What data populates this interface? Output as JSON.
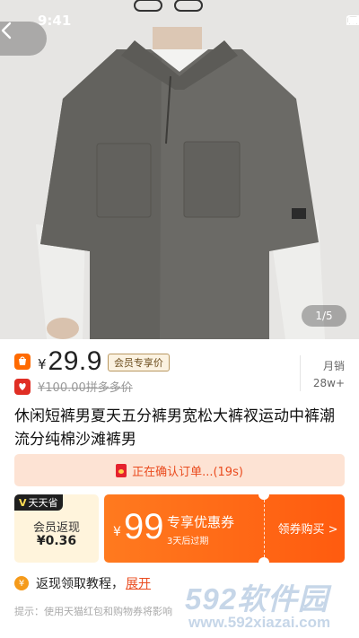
{
  "status_bar": {
    "time": "9:41"
  },
  "hero": {
    "image_counter": "1/5"
  },
  "price": {
    "currency": "¥",
    "current": "29.9",
    "member_tag": "会员专享价",
    "original": "¥100.00拼多多价",
    "sales_label": "月销",
    "sales_value": "28w+"
  },
  "product": {
    "title": "休闲短裤男夏天五分裤男宽松大裤衩运动中裤潮流分纯棉沙滩裤男"
  },
  "confirm_bar": {
    "text": "正在确认订单...(19s)"
  },
  "cashback": {
    "badge_v": "V",
    "badge_text": "天天省",
    "label": "会员返现",
    "value": "¥0.36"
  },
  "coupon": {
    "currency": "¥",
    "amount": "99",
    "title": "专享优惠券",
    "subtitle": "3天后过期",
    "cta": "领券购买 >"
  },
  "tutorial": {
    "icon": "¥",
    "text": "返现领取教程，",
    "link": "展开"
  },
  "tip": "提示：使用天猫红包和购物券将影响",
  "watermark": {
    "brand": "592软件园",
    "url": "www.592xiazai.com"
  },
  "colors": {
    "accent": "#ff6a00",
    "coupon_start": "#ff7a1f",
    "coupon_end": "#ff5b0f",
    "confirm_bg": "#fde3d4",
    "confirm_text": "#ea4b1e"
  },
  "icons": [
    "back-arrow-icon",
    "signal-icon",
    "wifi-icon",
    "battery-icon",
    "store-badge-icon",
    "pinduoduo-icon",
    "red-packet-icon",
    "coin-icon"
  ]
}
